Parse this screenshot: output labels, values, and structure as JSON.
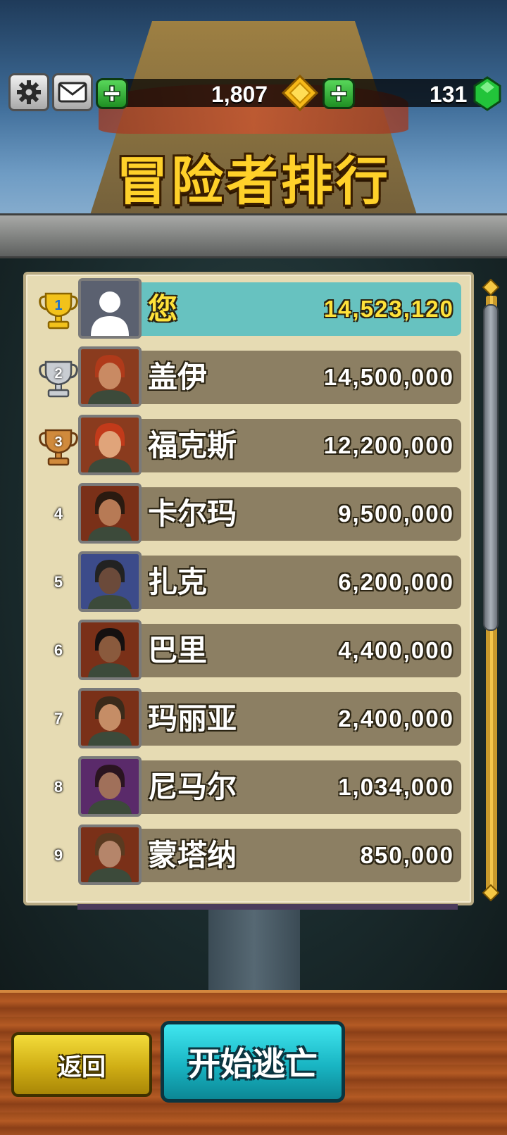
{
  "header": {
    "gold_amount": "1,807",
    "gem_amount": "131",
    "title": "冒险者排行"
  },
  "leaderboard": [
    {
      "rank": "1",
      "name": "您",
      "score": "14,523,120",
      "is_player": true,
      "trophy": "gold"
    },
    {
      "rank": "2",
      "name": "盖伊",
      "score": "14,500,000",
      "is_player": false,
      "trophy": "silver"
    },
    {
      "rank": "3",
      "name": "福克斯",
      "score": "12,200,000",
      "is_player": false,
      "trophy": "bronze"
    },
    {
      "rank": "4",
      "name": "卡尔玛",
      "score": "9,500,000",
      "is_player": false,
      "trophy": ""
    },
    {
      "rank": "5",
      "name": "扎克",
      "score": "6,200,000",
      "is_player": false,
      "trophy": ""
    },
    {
      "rank": "6",
      "name": "巴里",
      "score": "4,400,000",
      "is_player": false,
      "trophy": ""
    },
    {
      "rank": "7",
      "name": "玛丽亚",
      "score": "2,400,000",
      "is_player": false,
      "trophy": ""
    },
    {
      "rank": "8",
      "name": "尼马尔",
      "score": "1,034,000",
      "is_player": false,
      "trophy": ""
    },
    {
      "rank": "9",
      "name": "蒙塔纳",
      "score": "850,000",
      "is_player": false,
      "trophy": ""
    }
  ],
  "buttons": {
    "back_label": "返回",
    "start_label": "开始逃亡"
  },
  "icons": {
    "settings": "gear-icon",
    "mail": "mail-icon",
    "add": "plus-icon",
    "gold": "gold-coin-icon",
    "gem": "green-gem-icon",
    "trophy": "trophy-icon"
  },
  "colors": {
    "title": "#ffd12a",
    "player_row": "#67c2c0",
    "other_row": "#8c7f63",
    "panel": "#e6dbb3",
    "back_button": "#cfad14",
    "start_button": "#19b5c3"
  }
}
